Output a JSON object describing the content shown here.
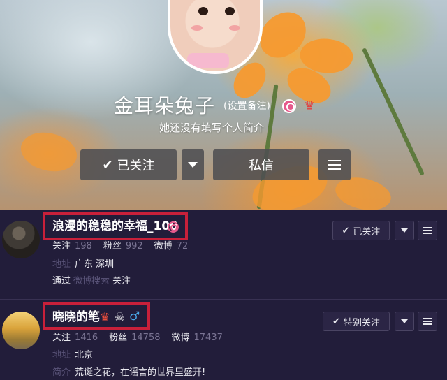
{
  "profile": {
    "nickname": "金耳朵兔子",
    "remark_link": "(设置备注)",
    "bio": "她还没有填写个人简介",
    "follow_label": "已关注",
    "message_label": "私信"
  },
  "users": [
    {
      "name": "浪漫的稳稳的幸福_100",
      "stats": [
        {
          "label": "关注",
          "value": "198"
        },
        {
          "label": "粉丝",
          "value": "992"
        },
        {
          "label": "微博",
          "value": "72"
        }
      ],
      "address_key": "地址",
      "address": "广东 深圳",
      "via_prefix": "通过",
      "via_source": "微博搜索",
      "via_suffix": "关注",
      "follow_label": "已关注"
    },
    {
      "name": "晓晓的笔",
      "stats": [
        {
          "label": "关注",
          "value": "1416"
        },
        {
          "label": "粉丝",
          "value": "14758"
        },
        {
          "label": "微博",
          "value": "17437"
        }
      ],
      "address_key": "地址",
      "address": "北京",
      "intro_key": "简介",
      "intro": "荒诞之花，在谣言的世界里盛开!",
      "follow_label": "特别关注"
    }
  ],
  "colors": {
    "highlight_box": "#c9203a",
    "list_background": "#221d3a",
    "vip_pink": "#e65a8c",
    "male_blue": "#4aa8e8"
  }
}
